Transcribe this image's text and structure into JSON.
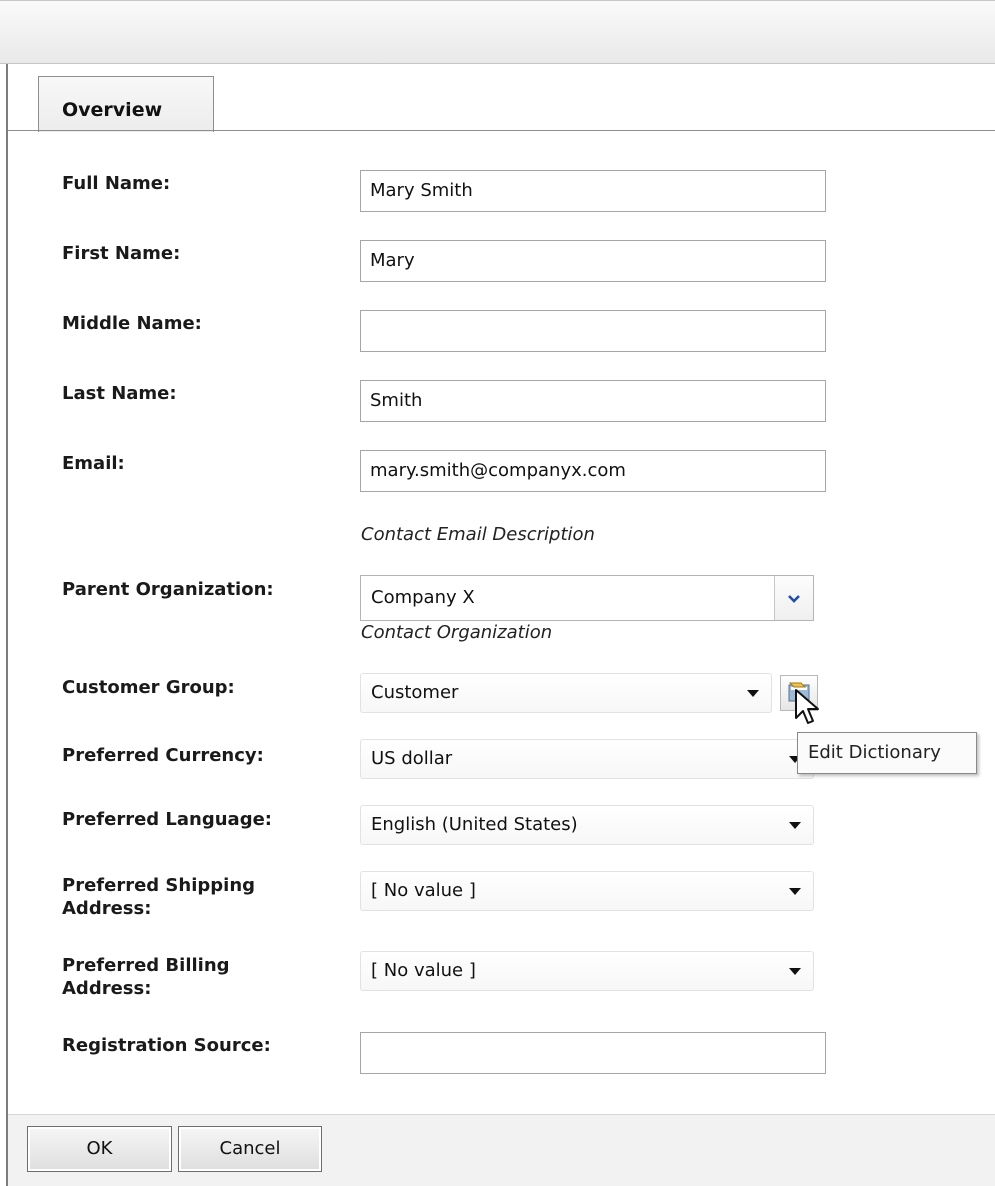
{
  "tabs": [
    {
      "label": "Overview",
      "selected": true
    }
  ],
  "form": {
    "full_name": {
      "label": "Full Name:",
      "value": "Mary Smith"
    },
    "first_name": {
      "label": "First Name:",
      "value": "Mary"
    },
    "middle_name": {
      "label": "Middle Name:",
      "value": ""
    },
    "last_name": {
      "label": "Last Name:",
      "value": "Smith"
    },
    "email": {
      "label": "Email:",
      "value": "mary.smith@companyx.com",
      "description": "Contact Email Description"
    },
    "parent_organization": {
      "label": "Parent Organization:",
      "value": "Company X",
      "description": "Contact Organization"
    },
    "customer_group": {
      "label": "Customer Group:",
      "value": "Customer"
    },
    "preferred_currency": {
      "label": "Preferred Currency:",
      "value": "US dollar"
    },
    "preferred_language": {
      "label": "Preferred Language:",
      "value": "English (United States)"
    },
    "preferred_shipping_address": {
      "label_line1": "Preferred Shipping",
      "label_line2": "Address:",
      "value": "[ No value ]"
    },
    "preferred_billing_address": {
      "label_line1": "Preferred Billing",
      "label_line2": "Address:",
      "value": "[ No value ]"
    },
    "registration_source": {
      "label": "Registration Source:",
      "value": ""
    }
  },
  "tooltip": {
    "text": "Edit Dictionary"
  },
  "icons": {
    "dropdown": "chevron-down-icon",
    "edit_dictionary": "edit-dictionary-icon",
    "cursor": "mouse-pointer-icon"
  },
  "buttons": {
    "ok": "OK",
    "cancel": "Cancel"
  },
  "colors": {
    "chevron": "#1f4fa6",
    "footer": "#f2f2f2",
    "tab_border": "#8e8e8e"
  }
}
